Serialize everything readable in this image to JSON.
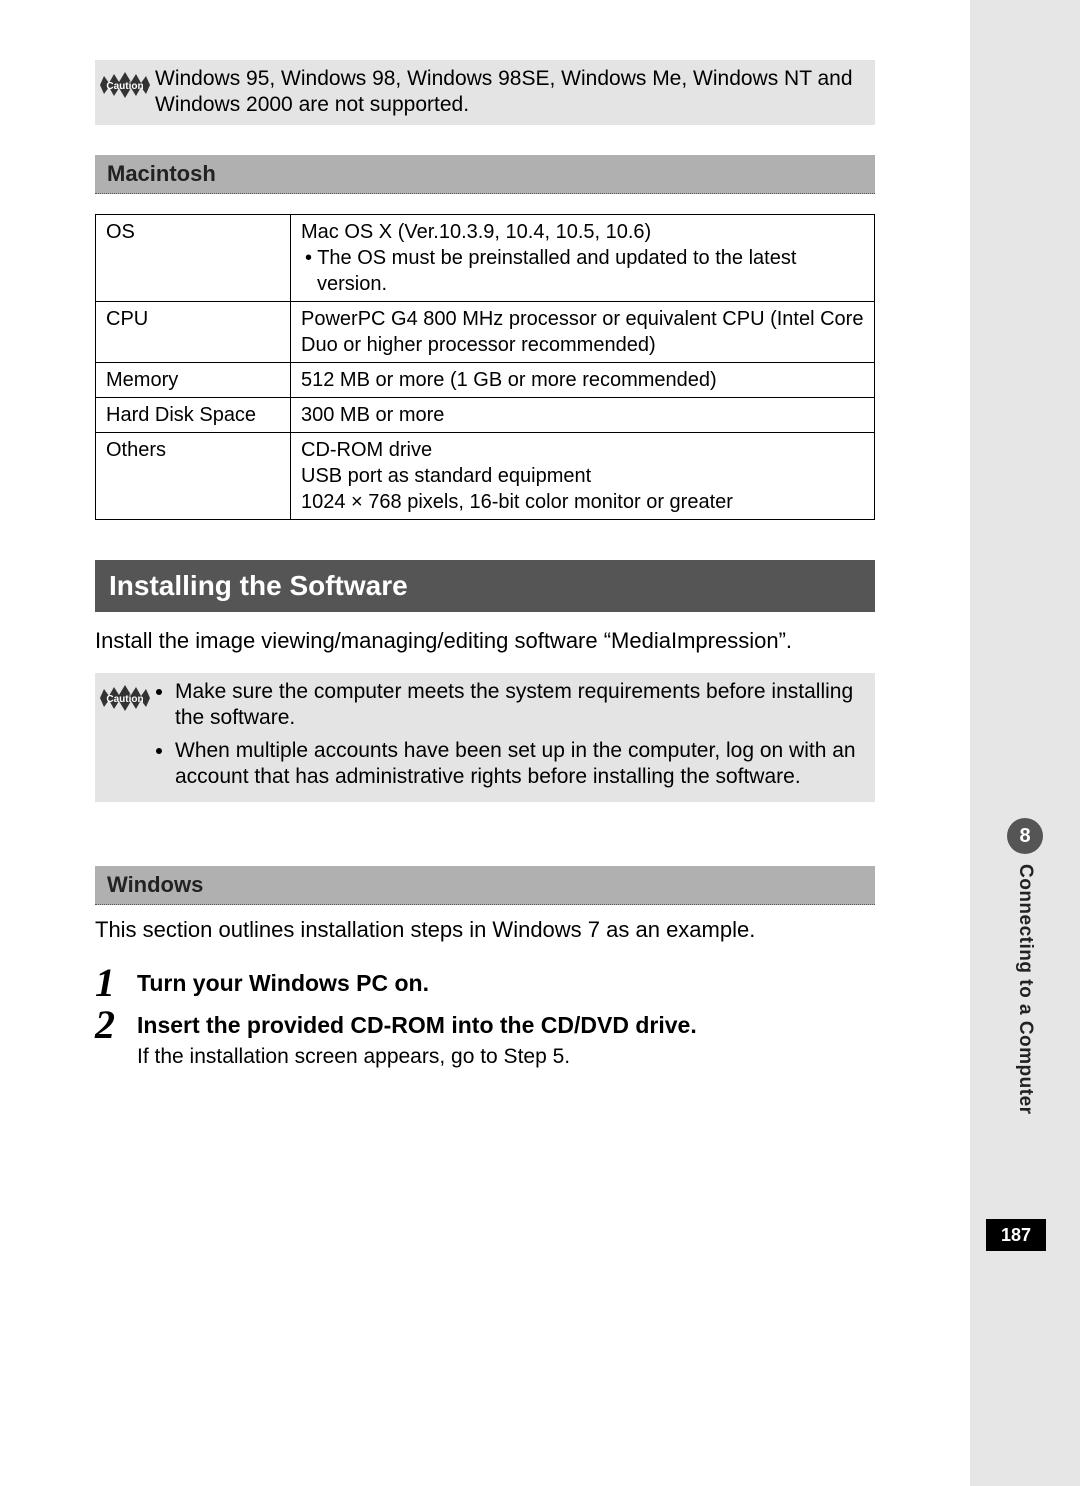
{
  "caution1": {
    "text": "Windows 95, Windows 98, Windows 98SE, Windows Me, Windows NT and Windows 2000 are not supported."
  },
  "mac_heading": "Macintosh",
  "mac_table": {
    "rows": [
      {
        "label": "OS",
        "value_main": "Mac OS X (Ver.10.3.9, 10.4, 10.5, 10.6)",
        "value_note": "• The OS must be preinstalled and updated to the latest version."
      },
      {
        "label": "CPU",
        "value_main": "PowerPC G4 800 MHz processor or equivalent CPU (Intel Core Duo or higher processor recommended)"
      },
      {
        "label": "Memory",
        "value_main": "512 MB or more (1 GB or more recommended)"
      },
      {
        "label": "Hard Disk Space",
        "value_main": "300 MB or more"
      },
      {
        "label": "Others",
        "value_main": "CD-ROM drive",
        "value_line2": "USB port as standard equipment",
        "value_line3": "1024 × 768 pixels, 16-bit color monitor or greater"
      }
    ]
  },
  "section_title": "Installing the Software",
  "section_intro": "Install the image viewing/managing/editing software “MediaImpression”.",
  "caution2": {
    "items": [
      "Make sure the computer meets the system requirements before installing the software.",
      "When multiple accounts have been set up in the computer, log on with an account that has administrative rights before installing the software."
    ]
  },
  "win_heading": "Windows",
  "win_intro": "This section outlines installation steps in Windows 7 as an example.",
  "steps": [
    {
      "num": "1",
      "title": "Turn your Windows PC on."
    },
    {
      "num": "2",
      "title": "Insert the provided CD-ROM into the CD/DVD drive.",
      "sub": "If the installation screen appears, go to Step 5."
    }
  ],
  "chapter": {
    "number": "8",
    "label": "Connecting to a Computer"
  },
  "page_number": "187",
  "icons": {
    "caution_label": "Caution"
  }
}
